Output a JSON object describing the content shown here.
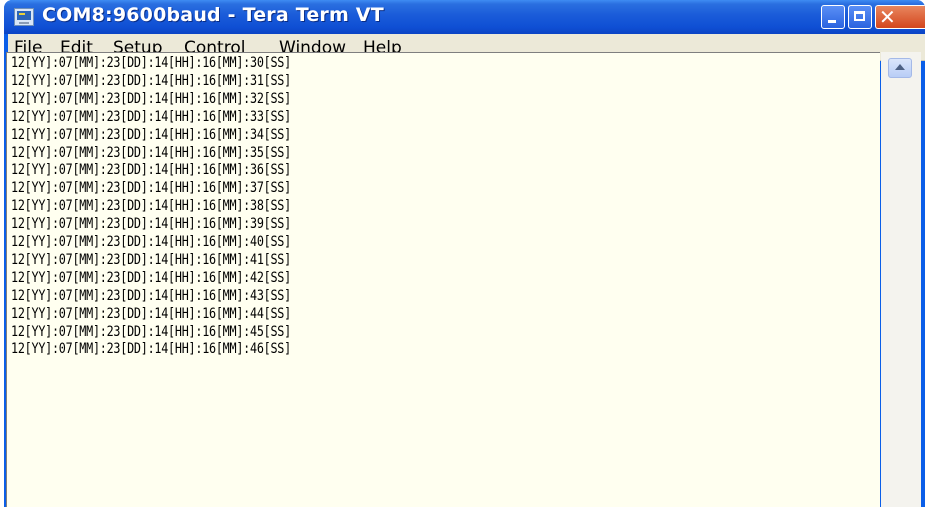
{
  "window": {
    "title": "COM8:9600baud - Tera Term VT"
  },
  "menu": {
    "items": [
      {
        "accel": "F",
        "rest": "ile"
      },
      {
        "accel": "E",
        "rest": "dit"
      },
      {
        "accel": "S",
        "rest": "etup"
      },
      {
        "pre": "C",
        "accel": "o",
        "rest": "ntrol"
      },
      {
        "accel": "W",
        "rest": "indow"
      },
      {
        "accel": "H",
        "rest": "elp"
      }
    ]
  },
  "terminal": {
    "lines": [
      "12[YY]:07[MM]:23[DD]:14[HH]:16[MM]:30[SS]",
      "12[YY]:07[MM]:23[DD]:14[HH]:16[MM]:31[SS]",
      "12[YY]:07[MM]:23[DD]:14[HH]:16[MM]:32[SS]",
      "12[YY]:07[MM]:23[DD]:14[HH]:16[MM]:33[SS]",
      "12[YY]:07[MM]:23[DD]:14[HH]:16[MM]:34[SS]",
      "12[YY]:07[MM]:23[DD]:14[HH]:16[MM]:35[SS]",
      "12[YY]:07[MM]:23[DD]:14[HH]:16[MM]:36[SS]",
      "12[YY]:07[MM]:23[DD]:14[HH]:16[MM]:37[SS]",
      "12[YY]:07[MM]:23[DD]:14[HH]:16[MM]:38[SS]",
      "12[YY]:07[MM]:23[DD]:14[HH]:16[MM]:39[SS]",
      "12[YY]:07[MM]:23[DD]:14[HH]:16[MM]:40[SS]",
      "12[YY]:07[MM]:23[DD]:14[HH]:16[MM]:41[SS]",
      "12[YY]:07[MM]:23[DD]:14[HH]:16[MM]:42[SS]",
      "12[YY]:07[MM]:23[DD]:14[HH]:16[MM]:43[SS]",
      "12[YY]:07[MM]:23[DD]:14[HH]:16[MM]:44[SS]",
      "12[YY]:07[MM]:23[DD]:14[HH]:16[MM]:45[SS]",
      "12[YY]:07[MM]:23[DD]:14[HH]:16[MM]:46[SS]"
    ]
  },
  "icons": {
    "app": "tera-term-icon",
    "minimize": "minimize-icon",
    "maximize": "maximize-icon",
    "close": "close-icon",
    "scroll_up": "scroll-up-arrow-icon"
  },
  "colors": {
    "titlebar": "#0f4fd4",
    "terminal_bg": "#fffff0",
    "close_button": "#d4461e"
  }
}
